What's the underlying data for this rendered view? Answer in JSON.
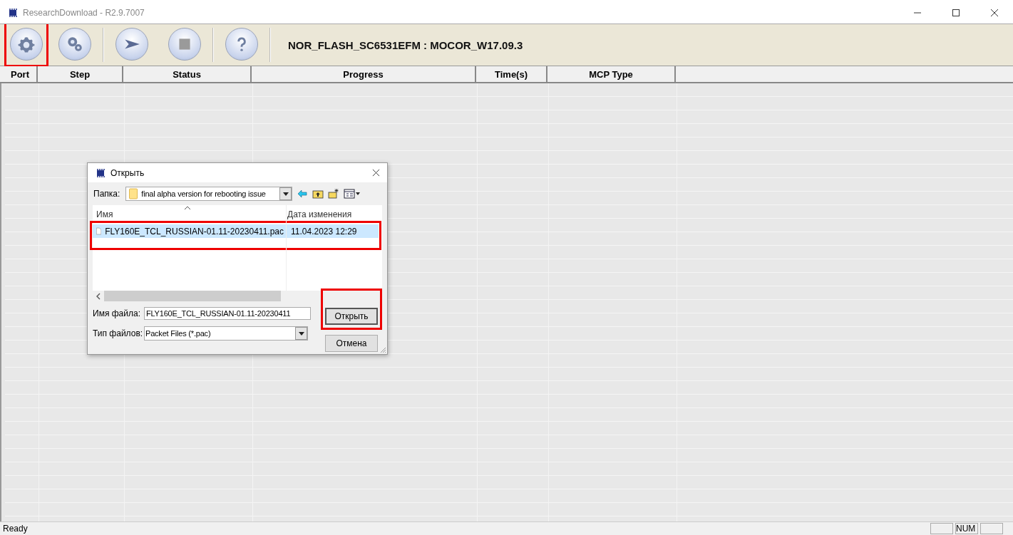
{
  "window": {
    "title": "ResearchDownload - R2.9.7007"
  },
  "toolbar": {
    "buttons": [
      {
        "kind": "gear",
        "highlighted": true
      },
      {
        "kind": "gears",
        "highlighted": false
      },
      {
        "kind": "play",
        "highlighted": false
      },
      {
        "kind": "stop",
        "highlighted": false
      },
      {
        "kind": "help",
        "highlighted": false
      }
    ],
    "product": "NOR_FLASH_SC6531EFM : MOCOR_W17.09.3"
  },
  "table": {
    "columns": [
      "Port",
      "Step",
      "Status",
      "Progress",
      "Time(s)",
      "MCP Type"
    ]
  },
  "dialog": {
    "title": "Открыть",
    "folder_label": "Папка:",
    "folder": "final alpha version for rebooting issue",
    "columns": [
      "Имя",
      "Дата изменения"
    ],
    "files": [
      {
        "name": "FLY160E_TCL_RUSSIAN-01.11-20230411.pac",
        "modified": "11.04.2023 12:29",
        "selected": true,
        "highlighted": true
      }
    ],
    "filename_label": "Имя файла:",
    "filename": "FLY160E_TCL_RUSSIAN-01.11-20230411",
    "filetype_label": "Тип файлов:",
    "filetype": "Packet Files (*.pac)",
    "buttons": [
      {
        "label": "Открыть",
        "highlighted": true
      },
      {
        "label": "Отмена",
        "highlighted": false
      }
    ]
  },
  "status_bar": {
    "text": "Ready",
    "indicator": "NUM"
  }
}
